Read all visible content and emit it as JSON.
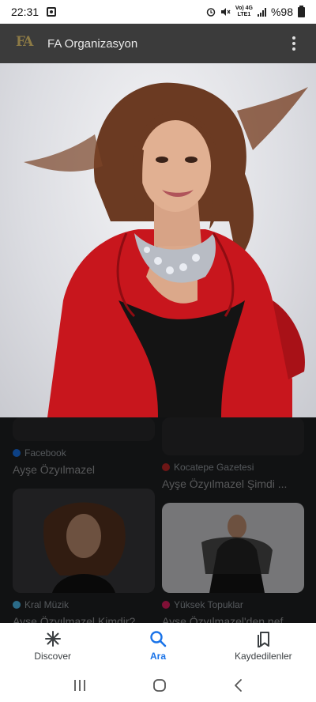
{
  "status_bar": {
    "time": "22:31",
    "network_top": "Vo) 4G",
    "network_bottom": "LTE1",
    "battery": "%98"
  },
  "app_header": {
    "logo_text": "FA",
    "title": "FA Organizasyon"
  },
  "results": [
    {
      "source": "Facebook",
      "source_color": "#1877f2",
      "title": "Ayşe Özyılmazel"
    },
    {
      "source": "Kocatepe Gazetesi",
      "source_color": "#c62828",
      "title": "Ayşe Özyılmazel Şimdi ..."
    },
    {
      "source": "Kral Müzik",
      "source_color": "#4fc3f7",
      "title": "Ayşe Özyılmazel Kimdir?"
    },
    {
      "source": "Yüksek Topuklar",
      "source_color": "#e91e63",
      "title": "Ayşe Özyılmazel'den nef"
    }
  ],
  "bottom_nav": {
    "items": [
      {
        "label": "Discover",
        "icon": "asterisk-icon"
      },
      {
        "label": "Ara",
        "icon": "search-icon",
        "active": true
      },
      {
        "label": "Kaydedilenler",
        "icon": "bookmark-icon"
      }
    ]
  }
}
